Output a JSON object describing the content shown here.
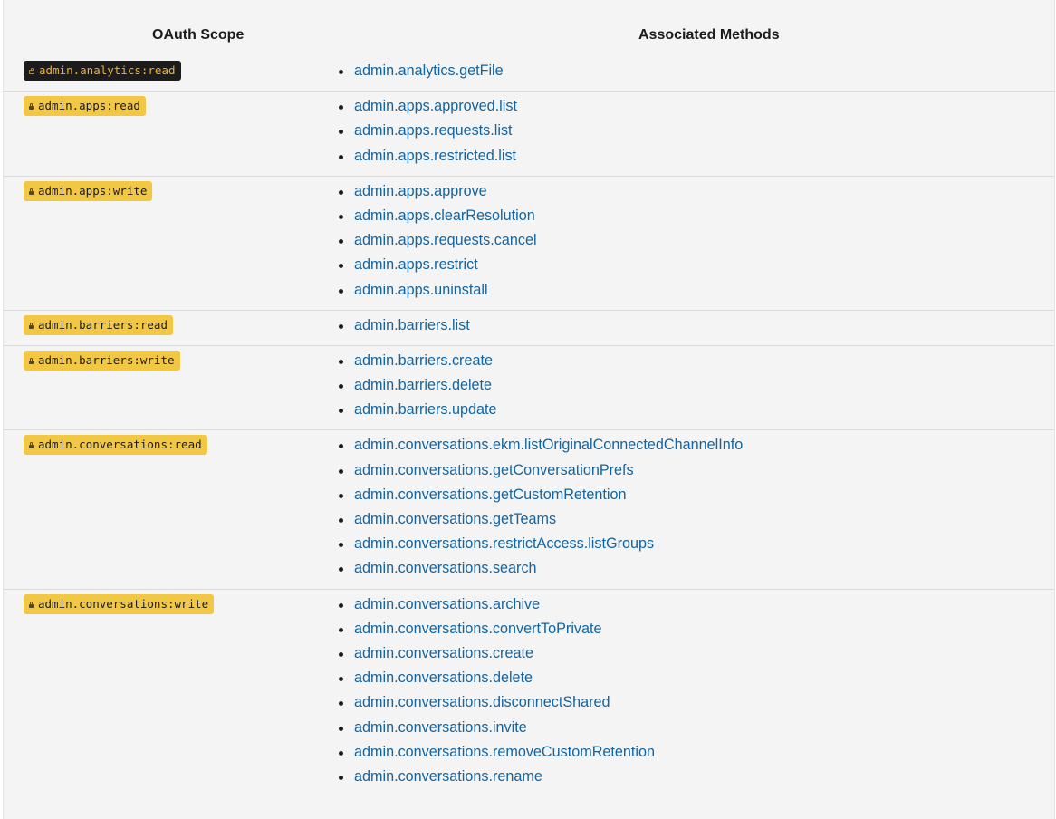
{
  "table": {
    "headers": {
      "scope": "OAuth Scope",
      "methods": "Associated Methods"
    },
    "rows": [
      {
        "scope": "admin.analytics:read",
        "style": "dark",
        "methods": [
          "admin.analytics.getFile"
        ]
      },
      {
        "scope": "admin.apps:read",
        "style": "yellow",
        "methods": [
          "admin.apps.approved.list",
          "admin.apps.requests.list",
          "admin.apps.restricted.list"
        ]
      },
      {
        "scope": "admin.apps:write",
        "style": "yellow",
        "methods": [
          "admin.apps.approve",
          "admin.apps.clearResolution",
          "admin.apps.requests.cancel",
          "admin.apps.restrict",
          "admin.apps.uninstall"
        ]
      },
      {
        "scope": "admin.barriers:read",
        "style": "yellow",
        "methods": [
          "admin.barriers.list"
        ]
      },
      {
        "scope": "admin.barriers:write",
        "style": "yellow",
        "methods": [
          "admin.barriers.create",
          "admin.barriers.delete",
          "admin.barriers.update"
        ]
      },
      {
        "scope": "admin.conversations:read",
        "style": "yellow",
        "methods": [
          "admin.conversations.ekm.listOriginalConnectedChannelInfo",
          "admin.conversations.getConversationPrefs",
          "admin.conversations.getCustomRetention",
          "admin.conversations.getTeams",
          "admin.conversations.restrictAccess.listGroups",
          "admin.conversations.search"
        ]
      },
      {
        "scope": "admin.conversations:write",
        "style": "yellow",
        "methods": [
          "admin.conversations.archive",
          "admin.conversations.convertToPrivate",
          "admin.conversations.create",
          "admin.conversations.delete",
          "admin.conversations.disconnectShared",
          "admin.conversations.invite",
          "admin.conversations.removeCustomRetention",
          "admin.conversations.rename"
        ]
      }
    ]
  },
  "colors": {
    "background": "#f4f4f4",
    "link": "#1264a3",
    "badge_yellow": "#f2c744",
    "badge_dark": "#1d1c1d",
    "divider": "#d9d9d9"
  },
  "icons": {
    "scope_badge_icon": "lock-icon"
  }
}
